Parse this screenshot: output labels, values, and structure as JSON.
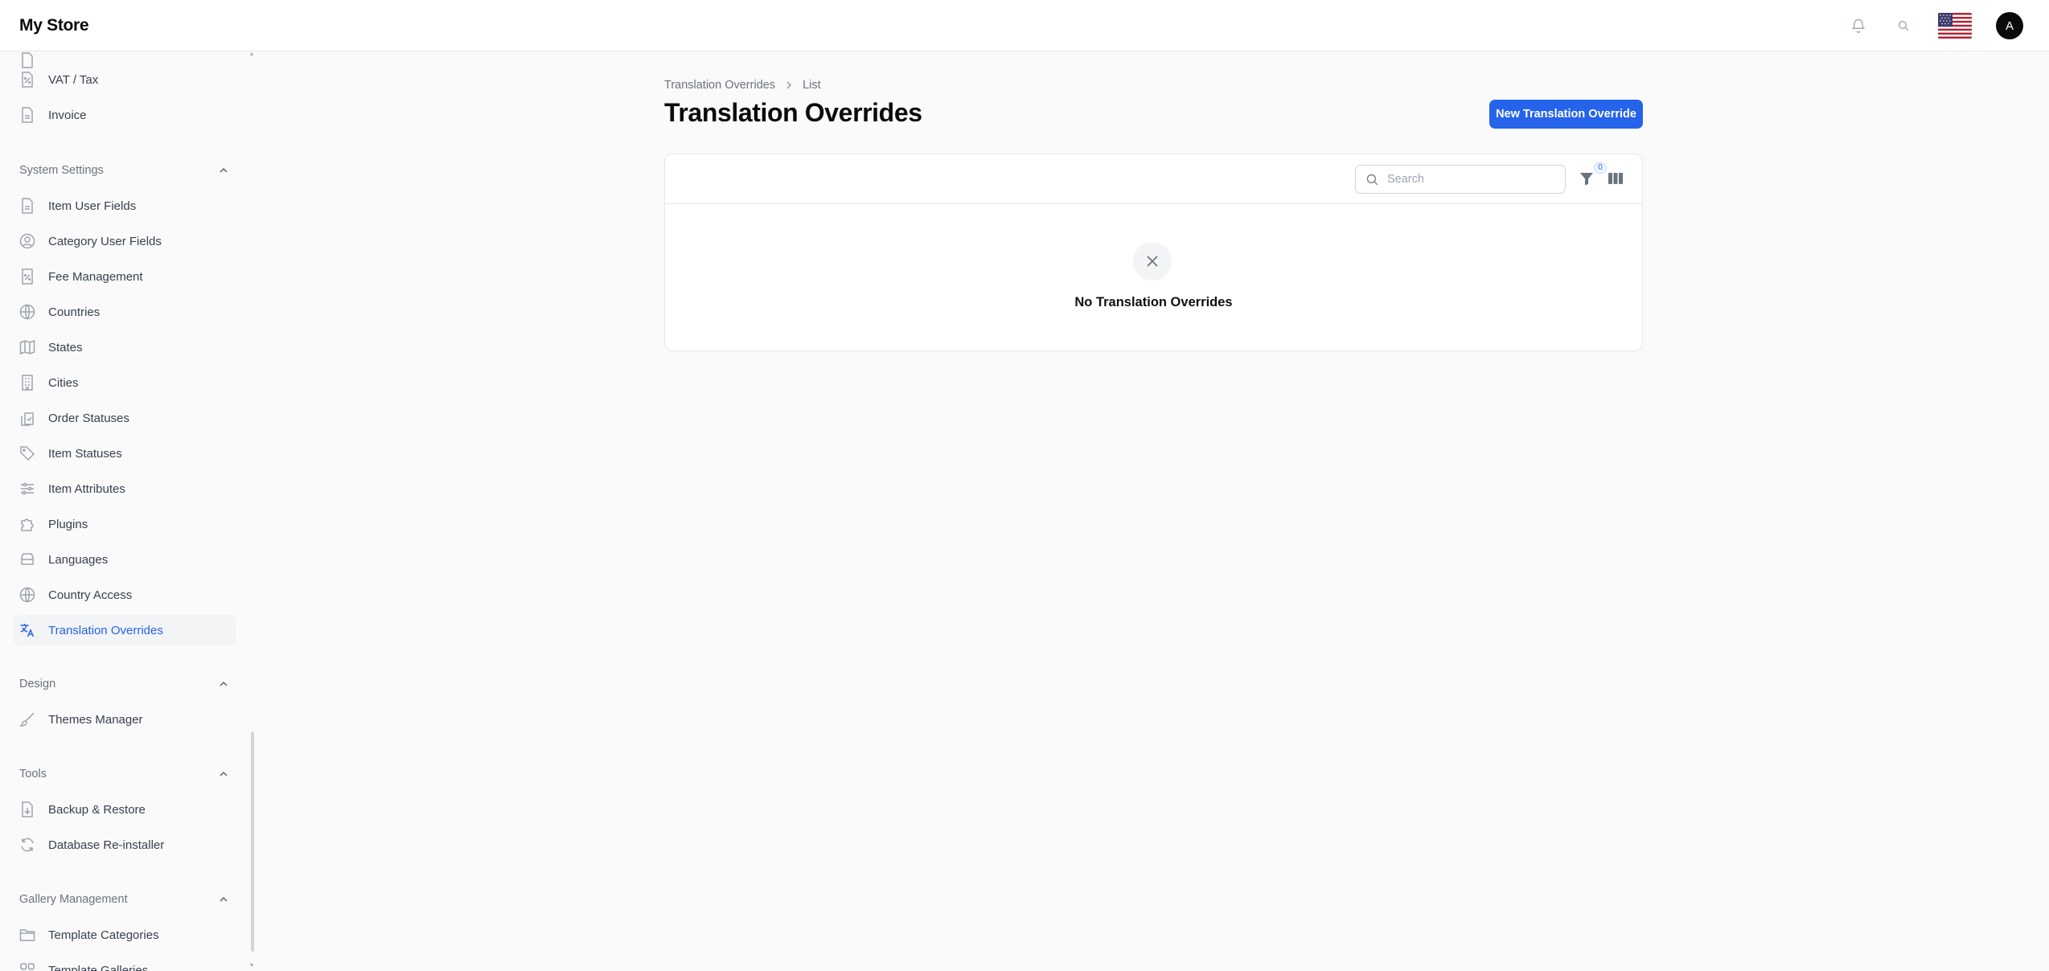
{
  "app": {
    "brand": "My Store"
  },
  "header": {
    "notification_icon": "bell-icon",
    "search_icon": "search-icon",
    "language_flag": "us-flag-icon",
    "avatar_initial": "A"
  },
  "sidebar": {
    "top_items": [
      {
        "label": "VAT / Tax",
        "icon": "percent-document-icon"
      },
      {
        "label": "Invoice",
        "icon": "document-icon"
      }
    ],
    "groups": [
      {
        "title": "System Settings",
        "items": [
          {
            "label": "Item User Fields",
            "icon": "document-icon"
          },
          {
            "label": "Category User Fields",
            "icon": "user-circle-icon"
          },
          {
            "label": "Fee Management",
            "icon": "percent-document-icon"
          },
          {
            "label": "Countries",
            "icon": "globe-icon"
          },
          {
            "label": "States",
            "icon": "map-icon"
          },
          {
            "label": "Cities",
            "icon": "building-icon"
          },
          {
            "label": "Order Statuses",
            "icon": "clipboard-icon"
          },
          {
            "label": "Item Statuses",
            "icon": "tag-icon"
          },
          {
            "label": "Item Attributes",
            "icon": "sliders-icon"
          },
          {
            "label": "Plugins",
            "icon": "puzzle-icon"
          },
          {
            "label": "Languages",
            "icon": "inbox-stack-icon"
          },
          {
            "label": "Country Access",
            "icon": "globe-icon"
          },
          {
            "label": "Translation Overrides",
            "icon": "language-icon",
            "active": true
          }
        ]
      },
      {
        "title": "Design",
        "items": [
          {
            "label": "Themes Manager",
            "icon": "paint-brush-icon"
          }
        ]
      },
      {
        "title": "Tools",
        "items": [
          {
            "label": "Backup & Restore",
            "icon": "download-document-icon"
          },
          {
            "label": "Database Re-installer",
            "icon": "refresh-icon"
          }
        ]
      },
      {
        "title": "Gallery Management",
        "items": [
          {
            "label": "Template Categories",
            "icon": "folder-icon"
          },
          {
            "label": "Template Galleries",
            "icon": "grid-icon"
          }
        ]
      }
    ]
  },
  "breadcrumb": {
    "parent": "Translation Overrides",
    "current": "List"
  },
  "page": {
    "title": "Translation Overrides",
    "new_button": "New Translation Override"
  },
  "table": {
    "search_placeholder": "Search",
    "filter_count": "0",
    "empty_message": "No Translation Overrides"
  },
  "colors": {
    "primary": "#2563eb",
    "background": "#fafafa"
  }
}
